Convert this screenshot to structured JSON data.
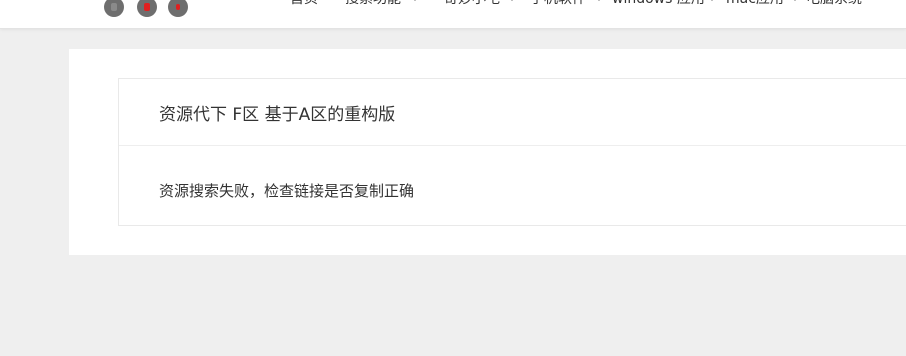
{
  "header": {
    "logo_icons": [
      "gray-face-icon",
      "red-mark-face-icon",
      "red-dot-face-icon"
    ],
    "nav": [
      {
        "label": "首页",
        "has_dropdown": false
      },
      {
        "label": "搜索功能",
        "has_dropdown": true
      },
      {
        "label": "奇妙小屯",
        "has_dropdown": true
      },
      {
        "label": "手机软件",
        "has_dropdown": true
      },
      {
        "label": "windows 应用",
        "has_dropdown": true
      },
      {
        "label": "mac应用",
        "has_dropdown": true
      },
      {
        "label": "电脑系统",
        "has_dropdown": false
      }
    ]
  },
  "panel": {
    "title": "资源代下 F区 基于A区的重构版",
    "message": "资源搜索失败，检查链接是否复制正确"
  },
  "colors": {
    "page_background": "#efefef",
    "card_background": "#ffffff",
    "text": "#333333",
    "accent_red": "#e02020"
  }
}
